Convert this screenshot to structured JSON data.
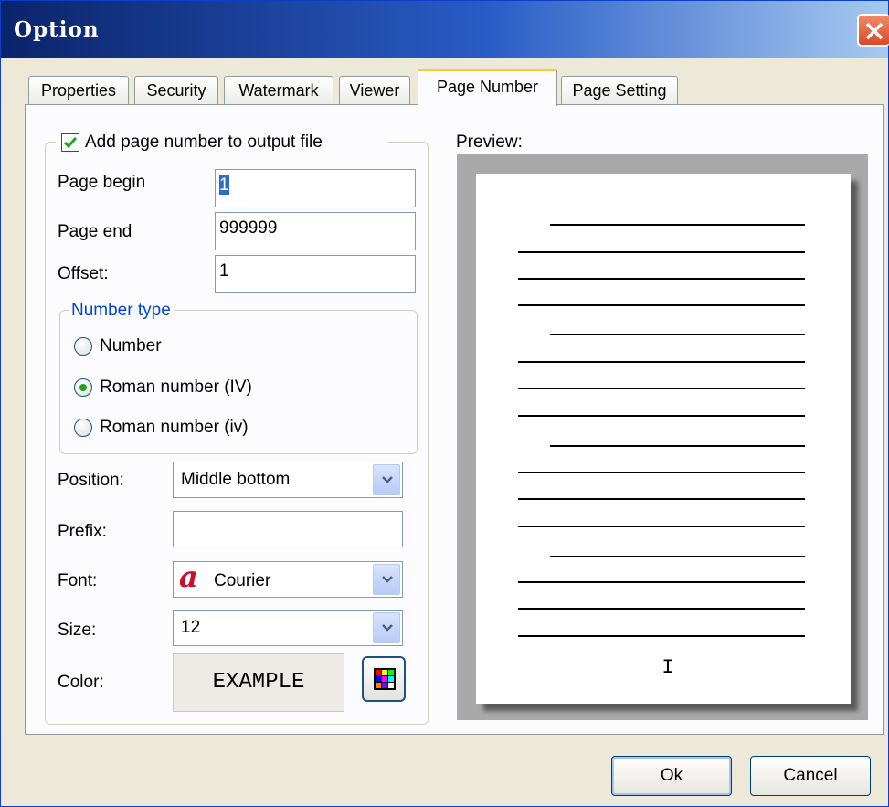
{
  "window": {
    "title": "Option"
  },
  "tabs": [
    {
      "label": "Properties",
      "active": false
    },
    {
      "label": "Security",
      "active": false
    },
    {
      "label": "Watermark",
      "active": false
    },
    {
      "label": "Viewer",
      "active": false
    },
    {
      "label": "Page Number",
      "active": true
    },
    {
      "label": "Page Setting",
      "active": false
    }
  ],
  "page_number": {
    "add_checkbox": {
      "label": "Add page number to output file",
      "checked": true
    },
    "page_begin": {
      "label": "Page begin",
      "value": "1"
    },
    "page_end": {
      "label": "Page end",
      "value": "999999"
    },
    "offset": {
      "label": "Offset:",
      "value": "1"
    },
    "number_type": {
      "legend": "Number type",
      "options": [
        {
          "label": "Number",
          "selected": false
        },
        {
          "label": "Roman number (IV)",
          "selected": true
        },
        {
          "label": "Roman number (iv)",
          "selected": false
        }
      ]
    },
    "position": {
      "label": "Position:",
      "value": "Middle bottom"
    },
    "prefix": {
      "label": "Prefix:",
      "value": ""
    },
    "font": {
      "label": "Font:",
      "icon": "font-icon",
      "icon_glyph": "a",
      "value": "Courier"
    },
    "size": {
      "label": "Size:",
      "value": "12"
    },
    "color": {
      "label": "Color:",
      "example": "EXAMPLE",
      "button_icon": "color-palette-icon"
    }
  },
  "preview": {
    "label": "Preview:",
    "page_number": "I"
  },
  "buttons": {
    "ok": "Ok",
    "cancel": "Cancel"
  },
  "colors": {
    "title_gradient_start": "#0a246a",
    "tab_highlight": "#ffc83c",
    "dialog_bg": "#ece9d8",
    "check_green": "#21a121",
    "font_icon_red": "#c8102e"
  }
}
